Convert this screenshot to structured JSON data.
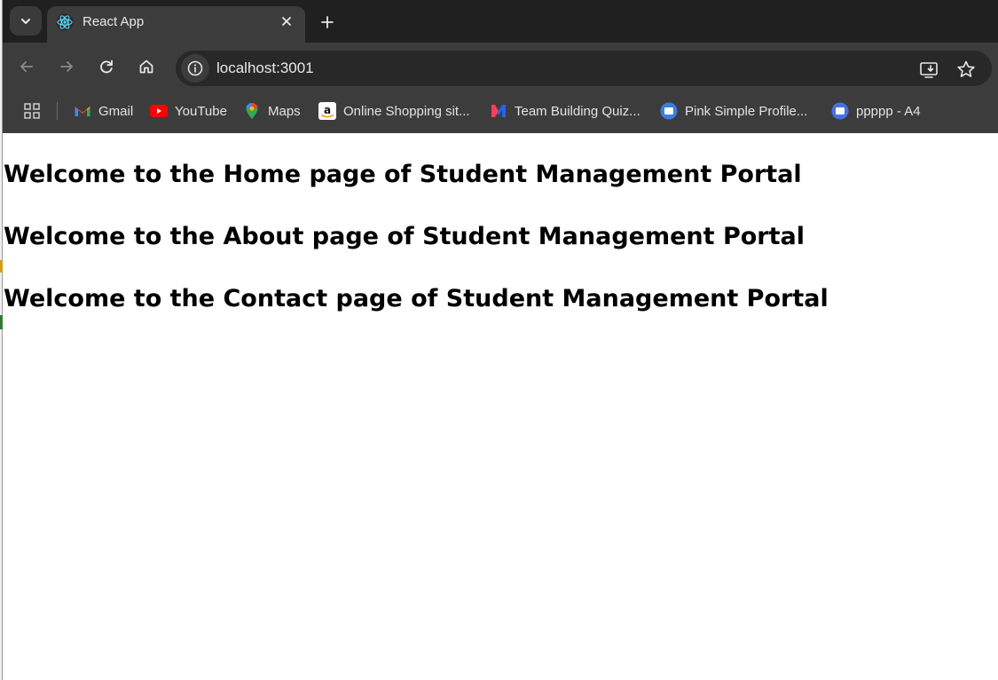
{
  "browser": {
    "tab": {
      "title": "React App"
    },
    "address_bar": {
      "url": "localhost:3001"
    },
    "bookmarks": [
      {
        "label": "Gmail",
        "icon": "gmail-icon"
      },
      {
        "label": "YouTube",
        "icon": "youtube-icon"
      },
      {
        "label": "Maps",
        "icon": "maps-icon"
      },
      {
        "label": "Online Shopping sit...",
        "icon": "amazon-icon"
      },
      {
        "label": "Team Building Quiz...",
        "icon": "quiz-icon"
      },
      {
        "label": "Pink Simple Profile...",
        "icon": "canva-icon"
      },
      {
        "label": "ppppp - A4",
        "icon": "canva-icon"
      }
    ]
  },
  "page": {
    "headings": [
      "Welcome to the Home page of Student Management Portal",
      "Welcome to the About page of Student Management Portal",
      "Welcome to the Contact page of Student Management Portal"
    ]
  },
  "colors": {
    "tabstrip": "#202020",
    "toolbar": "#3c3c3c",
    "omnibox": "#282828",
    "page_background": "#ffffff"
  }
}
